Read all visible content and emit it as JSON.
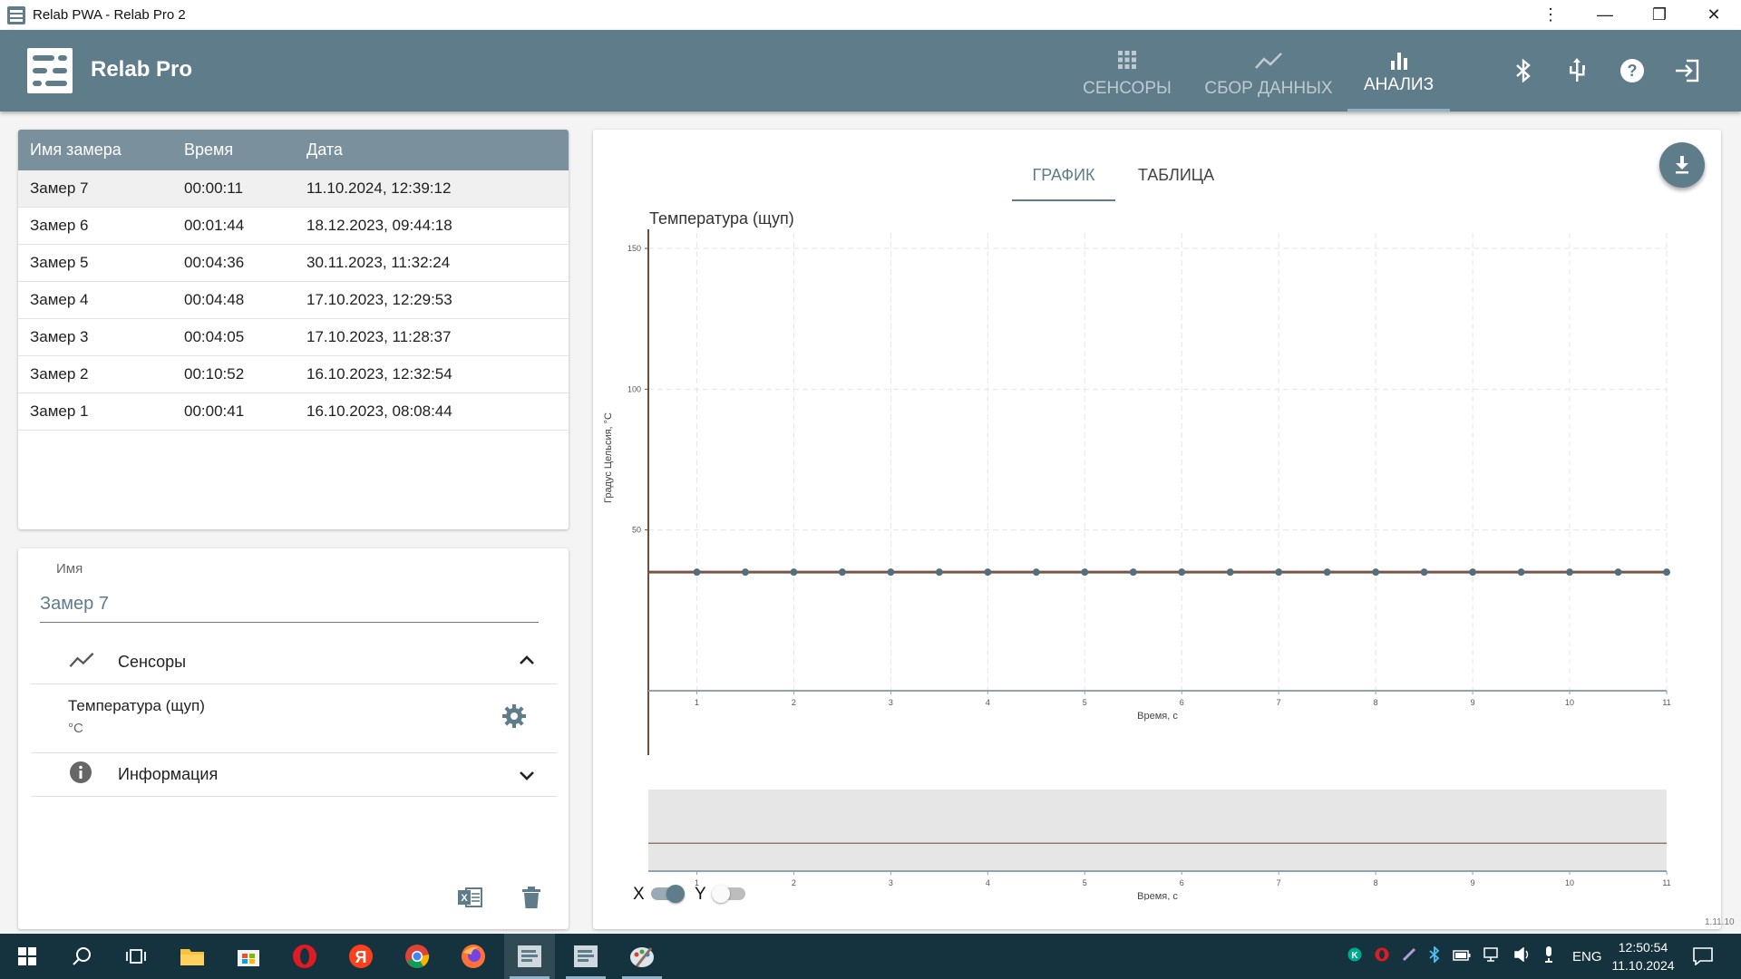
{
  "window": {
    "title": "Relab PWA - Relab Pro 2"
  },
  "appbar": {
    "brand": "Relab Pro",
    "tabs": [
      {
        "label": "СЕНСОРЫ",
        "icon": "grid-icon"
      },
      {
        "label": "СБОР ДАННЫХ",
        "icon": "trend-icon"
      },
      {
        "label": "АНАЛИЗ",
        "icon": "bar-chart-icon",
        "active": true
      }
    ],
    "actions": [
      "bluetooth-icon",
      "usb-icon",
      "help-icon",
      "logout-icon"
    ]
  },
  "measurements": {
    "headers": {
      "name": "Имя замера",
      "time": "Время",
      "date": "Дата"
    },
    "rows": [
      {
        "name": "Замер 7",
        "time": "00:00:11",
        "date": "11.10.2024, 12:39:12",
        "selected": true
      },
      {
        "name": "Замер 6",
        "time": "00:01:44",
        "date": "18.12.2023, 09:44:18"
      },
      {
        "name": "Замер 5",
        "time": "00:04:36",
        "date": "30.11.2023, 11:32:24"
      },
      {
        "name": "Замер 4",
        "time": "00:04:48",
        "date": "17.10.2023, 12:29:53"
      },
      {
        "name": "Замер 3",
        "time": "00:04:05",
        "date": "17.10.2023, 11:28:37"
      },
      {
        "name": "Замер 2",
        "time": "00:10:52",
        "date": "16.10.2023, 12:32:54"
      },
      {
        "name": "Замер 1",
        "time": "00:00:41",
        "date": "16.10.2023, 08:08:44"
      }
    ]
  },
  "details": {
    "name_label": "Имя",
    "name_value": "Замер 7",
    "sensors_label": "Сенсоры",
    "sensor": {
      "name": "Температура (щуп)",
      "unit": "°C"
    },
    "info_label": "Информация"
  },
  "chart_tabs": {
    "graph": "ГРАФИК",
    "table": "ТАБЛИЦА"
  },
  "chart_data": {
    "type": "line",
    "title": "Температура (щуп)",
    "xlabel": "Время, с",
    "ylabel": "Градус Цельсия, °C",
    "xlim": [
      0.5,
      11
    ],
    "ylim": [
      -30,
      160
    ],
    "xticks": [
      1,
      2,
      3,
      4,
      5,
      6,
      7,
      8,
      9,
      10,
      11
    ],
    "yticks": [
      50,
      100,
      150
    ],
    "grid": true,
    "series": [
      {
        "color": "#795548",
        "marker_color": "#546e7a",
        "x": [
          0.5,
          1,
          1.5,
          2,
          2.5,
          3,
          3.5,
          4,
          4.5,
          5,
          5.5,
          6,
          6.5,
          7,
          7.5,
          8,
          8.5,
          9,
          9.5,
          10,
          10.5,
          11
        ],
        "y": [
          35,
          35,
          35,
          35,
          35,
          35,
          35,
          35,
          35,
          35,
          35,
          35,
          35,
          35,
          35,
          35,
          35,
          35,
          35,
          35,
          35,
          35
        ]
      }
    ],
    "brush": {
      "xlabel": "Время, с",
      "xticks": [
        1,
        2,
        3,
        4,
        5,
        6,
        7,
        8,
        9,
        10,
        11
      ]
    }
  },
  "toggles": {
    "x_label": "X",
    "y_label": "Y",
    "x_on": true,
    "y_on": false
  },
  "version": "1.11.10",
  "taskbar": {
    "apps": [
      "windows-start-icon",
      "search-icon",
      "task-view-icon",
      "file-explorer-icon",
      "store-icon",
      "opera-icon",
      "yandex-icon",
      "chrome-icon",
      "firefox-icon",
      "relab-icon",
      "relab-pro-icon",
      "paint-icon"
    ],
    "lang": "ENG",
    "time": "12:50:54",
    "date": "11.10.2024"
  },
  "colors": {
    "primary": "#5f7c8a",
    "header": "#7a909c",
    "taskbar": "#15333e"
  }
}
